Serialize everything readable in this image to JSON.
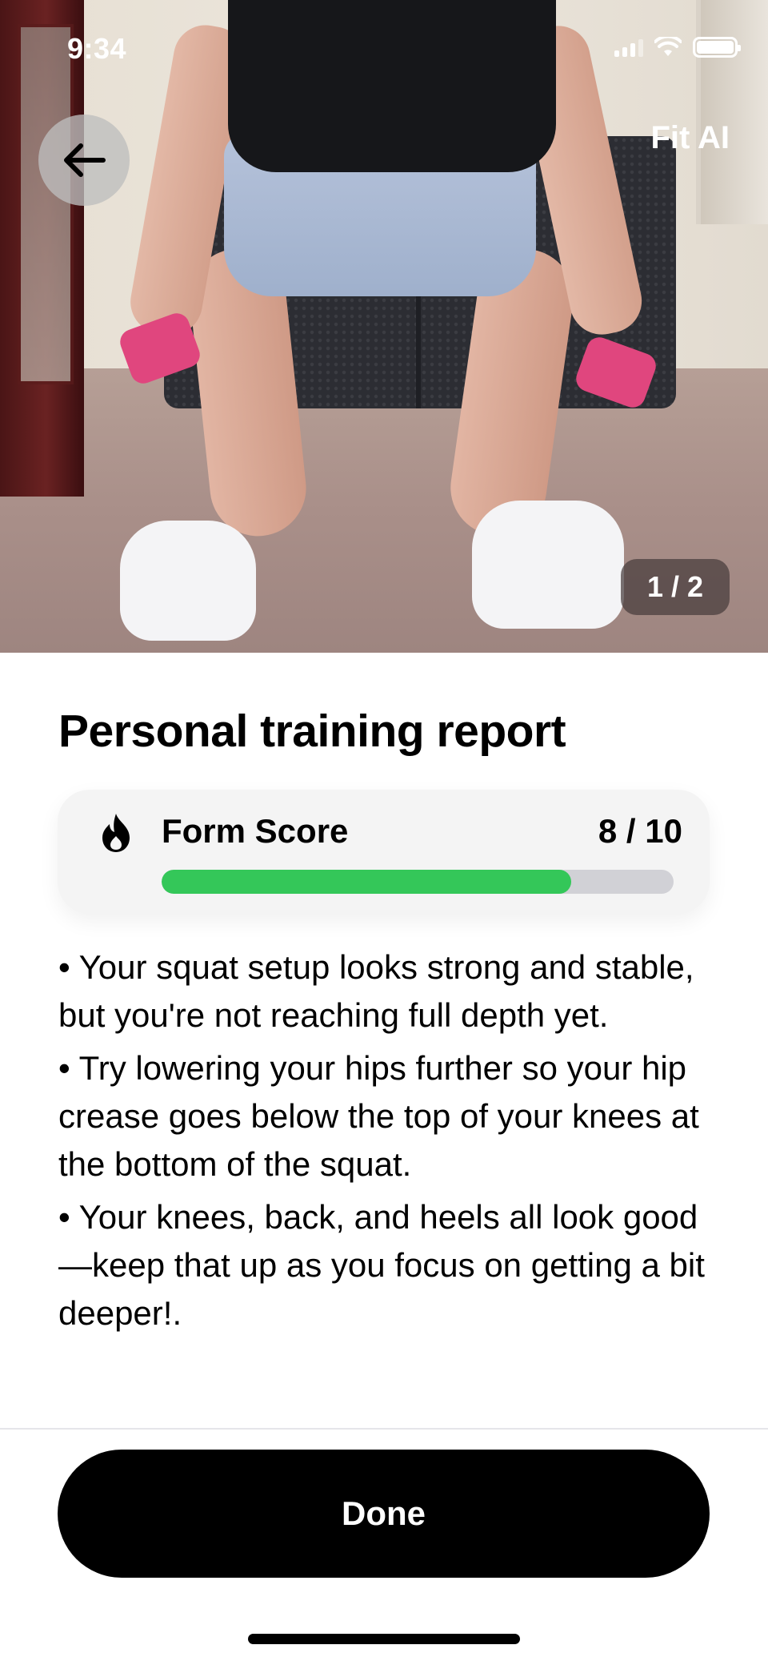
{
  "status_bar": {
    "time": "9:34",
    "icons": [
      "cellular-signal-icon",
      "wifi-icon",
      "battery-icon"
    ]
  },
  "header": {
    "back_icon": "arrow-left-icon",
    "brand": "Fit AI"
  },
  "media": {
    "counter": "1 / 2"
  },
  "report": {
    "title": "Personal training report",
    "form_score": {
      "icon": "flame-icon",
      "label": "Form Score",
      "value_text": "8 / 10",
      "value": 8,
      "max": 10,
      "progress_fraction": 0.8,
      "bar_color": "#34c759",
      "track_color": "#d1d1d6"
    },
    "notes": [
      "• Your squat setup looks strong and stable, but you're not reaching full depth yet.",
      "• Try lowering your hips further so your hip crease goes below the top of your knees at the bottom of the squat.",
      "• Your knees, back, and heels all look good—keep that up as you focus on getting a bit deeper!."
    ]
  },
  "footer": {
    "done_label": "Done"
  }
}
